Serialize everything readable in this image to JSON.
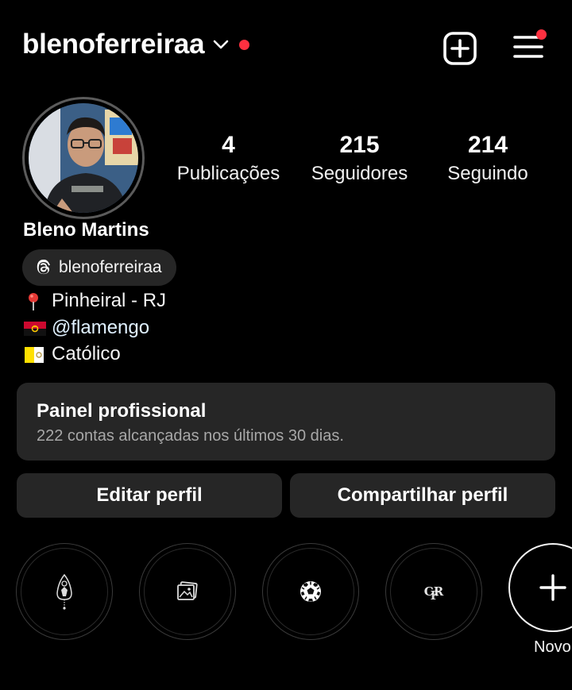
{
  "header": {
    "username": "blenoferreiraa",
    "icons": {
      "chevron": "chevron-down-icon",
      "create": "plus-square-icon",
      "menu": "hamburger-menu-icon"
    },
    "notification_color": "#ff3040"
  },
  "profile": {
    "avatar_icon": "profile-photo",
    "full_name": "Bleno Martins",
    "stats": [
      {
        "value": "4",
        "label": "Publicações"
      },
      {
        "value": "215",
        "label": "Seguidores"
      },
      {
        "value": "214",
        "label": "Seguindo"
      }
    ],
    "threads_handle": "blenoferreiraa",
    "bio": [
      {
        "icon": "pin-emoji",
        "text": "Pinheiral - RJ"
      },
      {
        "icon": "angola-flag-emoji",
        "text": "@flamengo"
      },
      {
        "icon": "vatican-flag-emoji",
        "text": "Católico"
      }
    ]
  },
  "dashboard": {
    "title": "Painel profissional",
    "subtitle": "222 contas alcançadas nos últimos 30 dias."
  },
  "actions": {
    "edit_label": "Editar perfil",
    "share_label": "Compartilhar perfil"
  },
  "highlights": {
    "items": [
      {
        "icon": "our-lady-icon"
      },
      {
        "icon": "photos-icon"
      },
      {
        "icon": "soccer-ball-icon"
      },
      {
        "icon": "flamengo-crest-icon"
      }
    ],
    "new_label": "Novo"
  },
  "colors": {
    "background": "#000000",
    "surface": "#262626",
    "secondary_text": "#a8a8a8",
    "accent_dot": "#ff3040"
  }
}
